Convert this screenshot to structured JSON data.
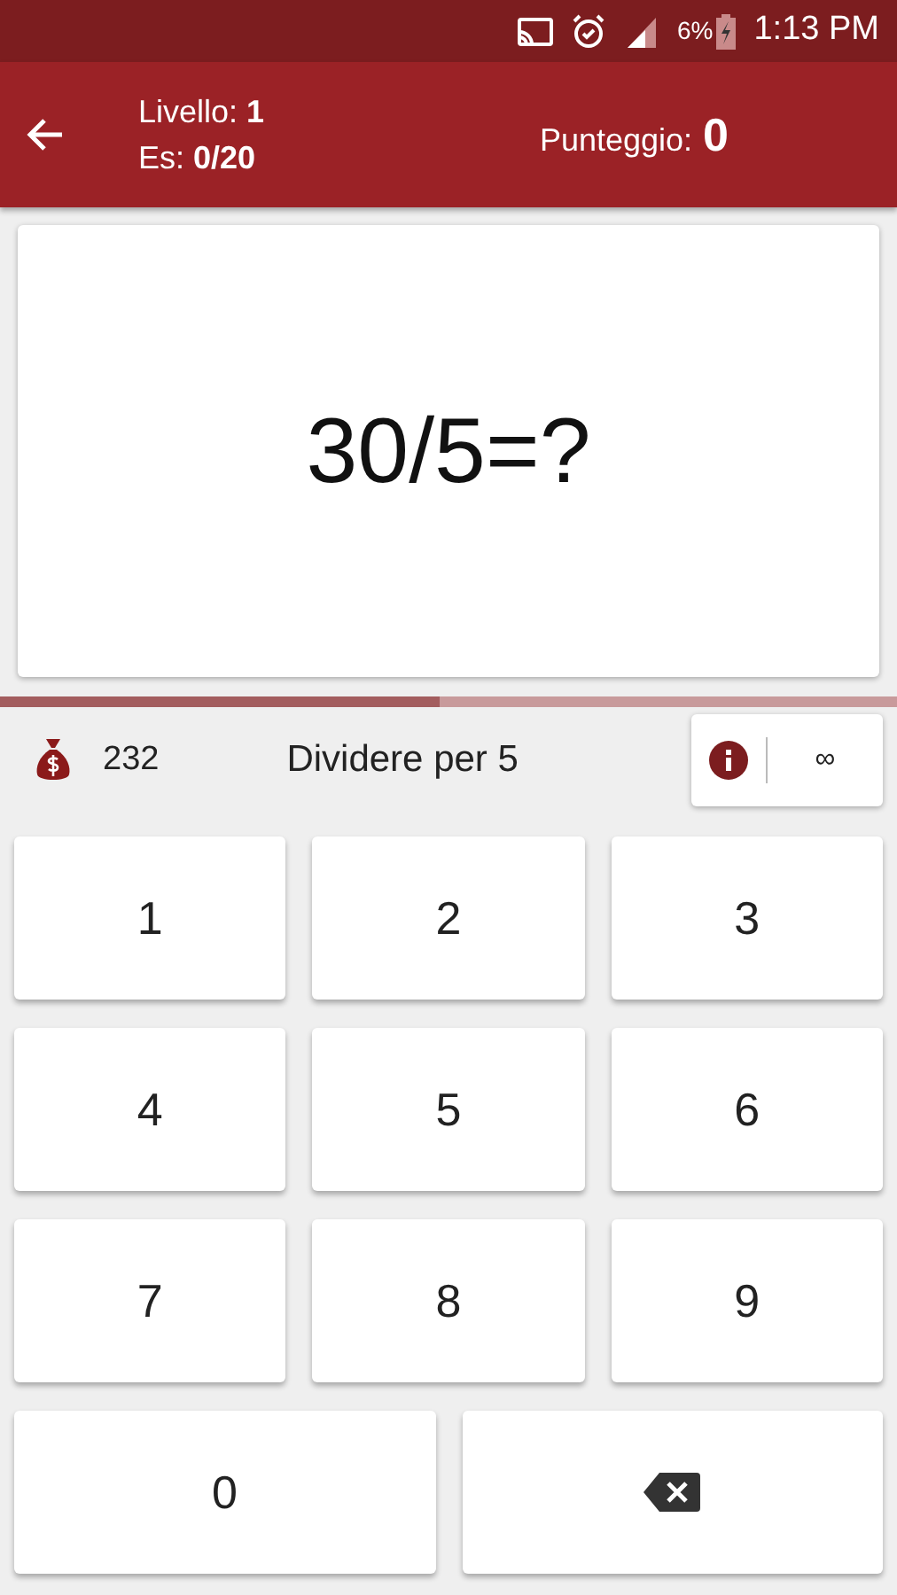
{
  "status_bar": {
    "battery": "6%",
    "time": "1:13 PM"
  },
  "header": {
    "level": "Livello: **1**",
    "exercise": "Es: **0/20**",
    "score_label": "Punteggio:",
    "score": "0"
  },
  "question": "30/5=?",
  "progress": {
    "level": 0.49
  },
  "info_row": {
    "coins": "232",
    "topic": "Dividere per 5",
    "timer": "∞"
  },
  "keys": [
    {
      "kind": "digit",
      "label": "1"
    },
    {
      "kind": "digit",
      "label": "2"
    },
    {
      "kind": "digit",
      "label": "3"
    },
    {
      "kind": "digit",
      "label": "4"
    },
    {
      "kind": "digit",
      "label": "5"
    },
    {
      "kind": "digit",
      "label": "6"
    },
    {
      "kind": "digit",
      "label": "7"
    },
    {
      "kind": "digit",
      "label": "8"
    },
    {
      "kind": "digit",
      "label": "9"
    },
    {
      "kind": "digit",
      "label": "0"
    },
    {
      "kind": "backspace"
    }
  ]
}
